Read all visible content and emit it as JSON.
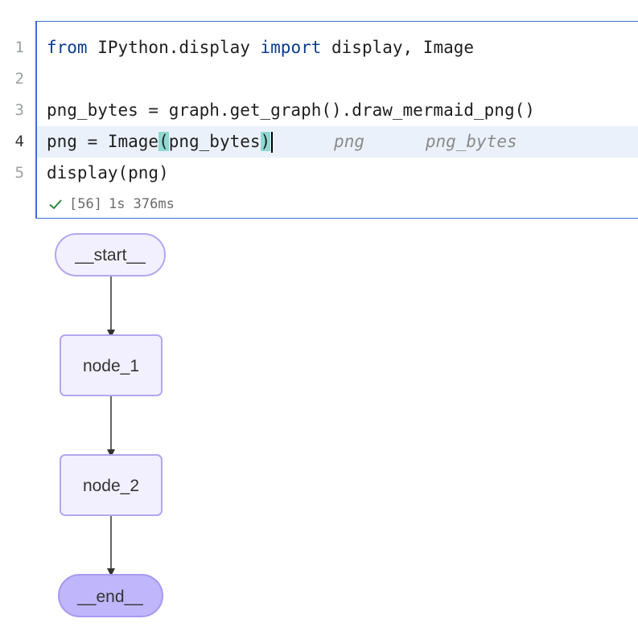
{
  "editor": {
    "line_numbers": [
      "1",
      "2",
      "3",
      "4",
      "5"
    ],
    "active_line": 4,
    "lines": {
      "l1": {
        "kw_from": "from",
        "mod": " IPython.display ",
        "kw_import": "import",
        "rest": " display, Image"
      },
      "l2": "",
      "l3": "png_bytes = graph.get_graph().draw_mermaid_png()",
      "l4": {
        "pre": "png = Image",
        "open": "(",
        "arg": "png_bytes",
        "close": ")",
        "hint1": "png",
        "hint2": "png_bytes"
      },
      "l5": "display(png)"
    }
  },
  "status": {
    "check_icon": "check-icon",
    "execution_count": "[56]",
    "duration": "1s 376ms"
  },
  "graph": {
    "nodes": [
      "__start__",
      "node_1",
      "node_2",
      "__end__"
    ],
    "colors": {
      "node_fill": "#f2f0ff",
      "node_border": "#b5a6f0",
      "end_fill": "#bfb6fc",
      "edge": "#333333"
    }
  }
}
